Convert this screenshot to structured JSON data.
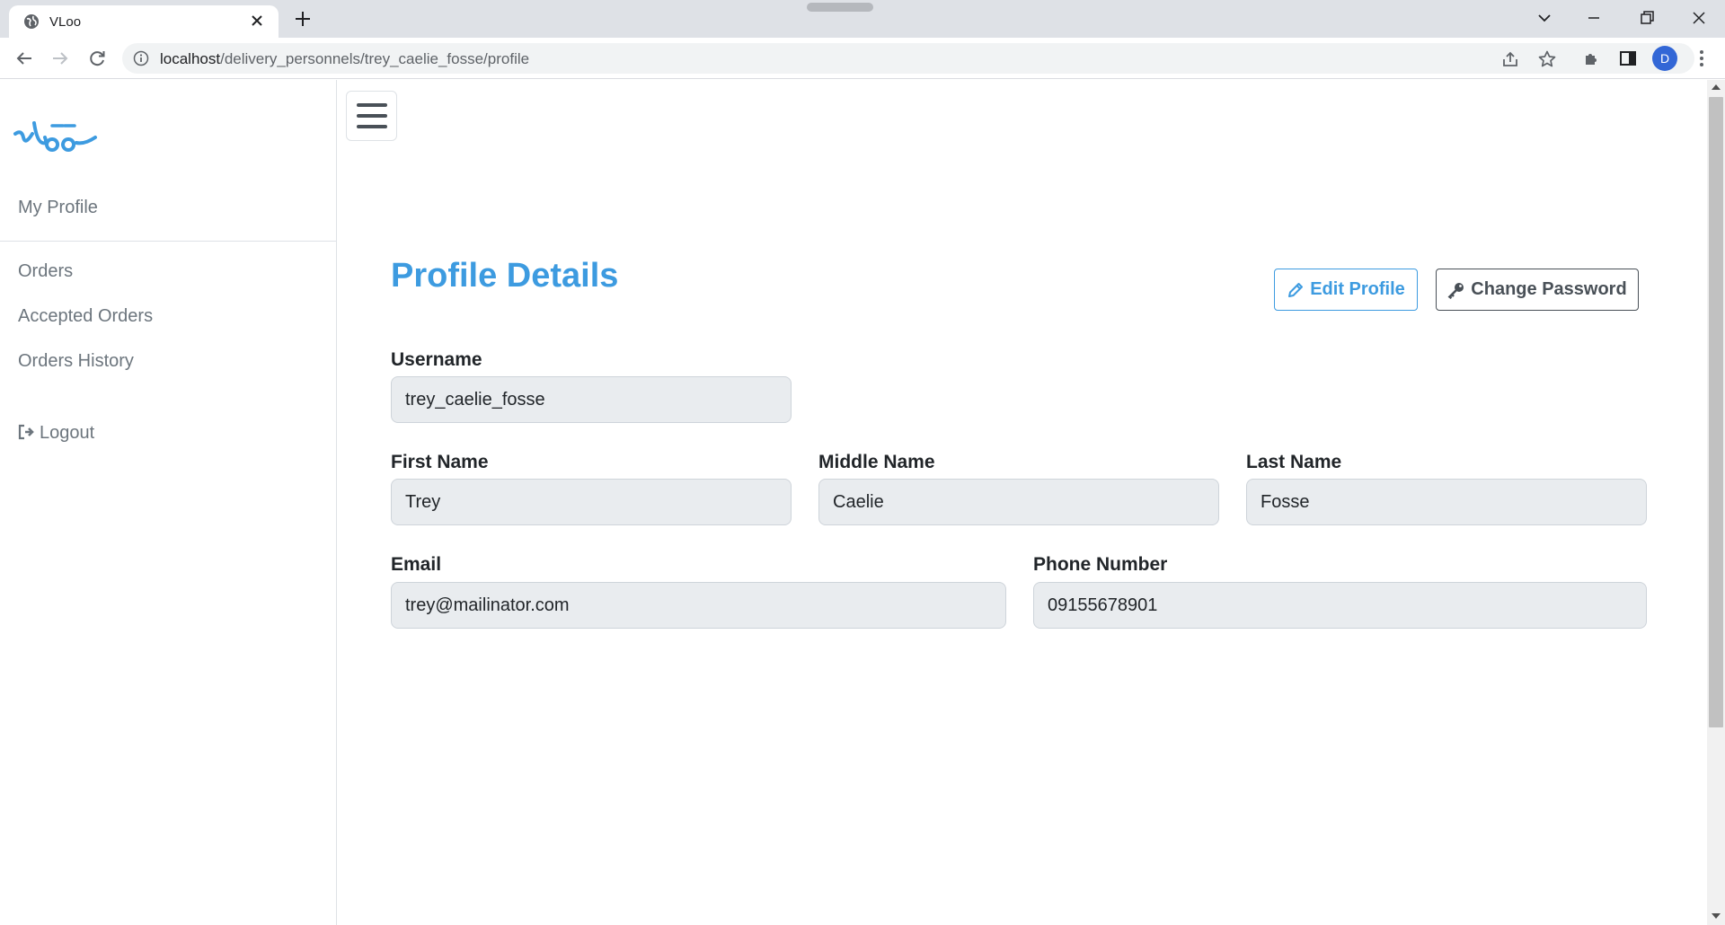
{
  "browser": {
    "tab_title": "VLoo",
    "url_host": "localhost",
    "url_path": "/delivery_personnels/trey_caelie_fosse/profile",
    "profile_initial": "D"
  },
  "sidebar": {
    "logo_text": "vloo",
    "items": [
      {
        "label": "My Profile"
      },
      {
        "label": "Orders"
      },
      {
        "label": "Accepted Orders"
      },
      {
        "label": "Orders History"
      }
    ],
    "logout_label": "Logout"
  },
  "main": {
    "title": "Profile Details",
    "edit_button": "Edit Profile",
    "change_password_button": "Change Password",
    "fields": {
      "username": {
        "label": "Username",
        "value": "trey_caelie_fosse"
      },
      "first_name": {
        "label": "First Name",
        "value": "Trey"
      },
      "middle_name": {
        "label": "Middle Name",
        "value": "Caelie"
      },
      "last_name": {
        "label": "Last Name",
        "value": "Fosse"
      },
      "email": {
        "label": "Email",
        "value": "trey@mailinator.com"
      },
      "phone": {
        "label": "Phone Number",
        "value": "09155678901"
      }
    }
  },
  "colors": {
    "accent": "#3d9be0",
    "sidebar_text": "#6c757d",
    "input_bg": "#e9ecef"
  }
}
